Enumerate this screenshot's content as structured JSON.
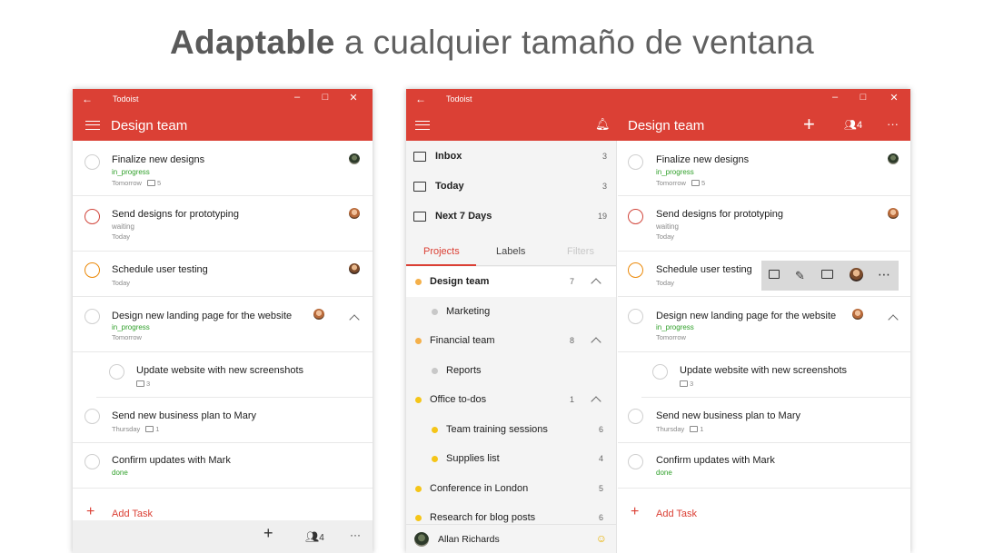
{
  "headline": {
    "bold": "Adaptable",
    "rest": " a cualquier tamaño de ventana"
  },
  "window_small": {
    "app_title": "Todoist",
    "page_title": "Design team",
    "tasks": [
      {
        "name": "Finalize new designs",
        "label": "in_progress",
        "meta": "Tomorrow",
        "comments": "5"
      },
      {
        "name": "Send designs for prototyping",
        "label": "waiting",
        "meta": "Today"
      },
      {
        "name": "Schedule user testing",
        "meta": "Today"
      },
      {
        "name": "Design new landing page for the website",
        "label": "in_progress",
        "meta": "Tomorrow"
      },
      {
        "name": "Update website with new screenshots",
        "comments": "3"
      },
      {
        "name": "Send new business plan to Mary",
        "meta": "Thursday",
        "comments": "1"
      },
      {
        "name": "Confirm updates with Mark",
        "label": "done"
      }
    ],
    "add_task": "Add Task",
    "member_count": "4",
    "more": "···"
  },
  "window_large": {
    "app_title": "Todoist",
    "page_title": "Design team",
    "member_count": "4",
    "more": "···",
    "nav": [
      {
        "label": "Inbox",
        "count": "3"
      },
      {
        "label": "Today",
        "count": "3"
      },
      {
        "label": "Next 7 Days",
        "count": "19"
      }
    ],
    "tabs": [
      "Projects",
      "Labels",
      "Filters"
    ],
    "projects": [
      {
        "name": "Design team",
        "count": "7",
        "color": "#f4b04a"
      },
      {
        "name": "Marketing",
        "color": "#c8c8c8"
      },
      {
        "name": "Financial team",
        "count": "8",
        "color": "#f4b04a"
      },
      {
        "name": "Reports",
        "color": "#c8c8c8"
      },
      {
        "name": "Office to-dos",
        "count": "1",
        "color": "#f5c518"
      },
      {
        "name": "Team training sessions",
        "count": "6",
        "color": "#f5c518"
      },
      {
        "name": "Supplies list",
        "count": "4",
        "color": "#f5c518"
      },
      {
        "name": "Conference in London",
        "count": "5",
        "color": "#f5c518"
      },
      {
        "name": "Research for blog posts",
        "count": "6",
        "color": "#f5c518"
      }
    ],
    "user_name": "Allan Richards",
    "tasks": [
      {
        "name": "Finalize new designs",
        "label": "in_progress",
        "meta": "Tomorrow",
        "comments": "5"
      },
      {
        "name": "Send designs for prototyping",
        "label": "waiting",
        "meta": "Today"
      },
      {
        "name": "Schedule user testing",
        "meta": "Today"
      },
      {
        "name": "Design new landing page for the website",
        "label": "in_progress",
        "meta": "Tomorrow"
      },
      {
        "name": "Update website with new screenshots",
        "comments": "3"
      },
      {
        "name": "Send new business plan to Mary",
        "meta": "Thursday",
        "comments": "1"
      },
      {
        "name": "Confirm updates with Mark",
        "label": "done"
      }
    ],
    "add_task": "Add Task"
  },
  "colors": {
    "brand": "#db4035",
    "label_green": "#30a02a",
    "priority_red": "#d1453b",
    "priority_orange": "#eb8909"
  }
}
